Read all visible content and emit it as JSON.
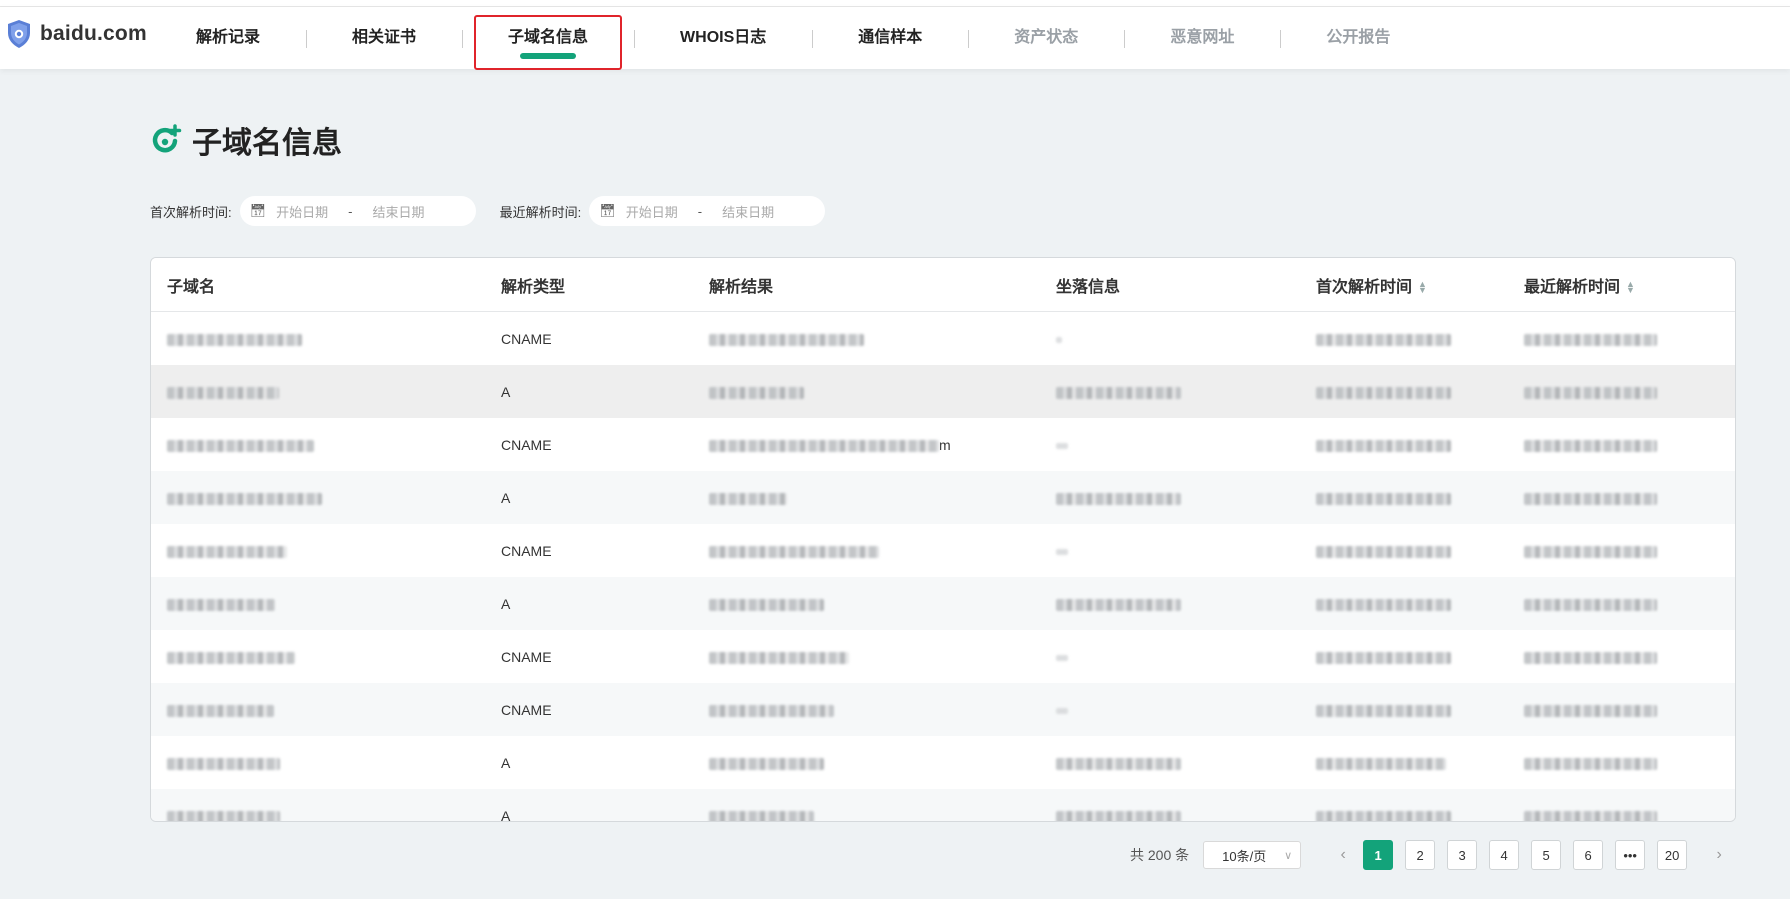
{
  "brand": {
    "name": "baidu.com",
    "accent": "#13a37a",
    "highlight": "#e0242b"
  },
  "nav": {
    "tabs": [
      {
        "label": "解析记录",
        "state": "normal"
      },
      {
        "label": "相关证书",
        "state": "normal"
      },
      {
        "label": "子域名信息",
        "state": "active"
      },
      {
        "label": "WHOIS日志",
        "state": "normal"
      },
      {
        "label": "通信样本",
        "state": "normal"
      },
      {
        "label": "资产状态",
        "state": "disabled"
      },
      {
        "label": "恶意网址",
        "state": "disabled"
      },
      {
        "label": "公开报告",
        "state": "disabled"
      }
    ]
  },
  "page": {
    "title": "子域名信息",
    "icon": "subdomain-icon"
  },
  "filters": {
    "first_label": "首次解析时间:",
    "recent_label": "最近解析时间:",
    "start_placeholder": "开始日期",
    "end_placeholder": "结束日期",
    "separator": "-"
  },
  "table": {
    "columns": [
      "子域名",
      "解析类型",
      "解析结果",
      "坐落信息",
      "首次解析时间",
      "最近解析时间"
    ],
    "rows": [
      {
        "type": "CNAME",
        "result_suffix": ""
      },
      {
        "type": "A",
        "result_suffix": ""
      },
      {
        "type": "CNAME",
        "result_suffix": "m"
      },
      {
        "type": "A",
        "result_suffix": ""
      },
      {
        "type": "CNAME",
        "result_suffix": ""
      },
      {
        "type": "A",
        "result_suffix": ""
      },
      {
        "type": "CNAME",
        "result_suffix": ""
      },
      {
        "type": "CNAME",
        "result_suffix": ""
      },
      {
        "type": "A",
        "result_suffix": ""
      },
      {
        "type": "A",
        "result_suffix": ""
      }
    ]
  },
  "pagination": {
    "total": "共 200 条",
    "page_size": "10条/页",
    "pages": [
      "1",
      "2",
      "3",
      "4",
      "5",
      "6",
      "•••",
      "20"
    ],
    "current": "1",
    "prev": "‹",
    "next": "›"
  }
}
